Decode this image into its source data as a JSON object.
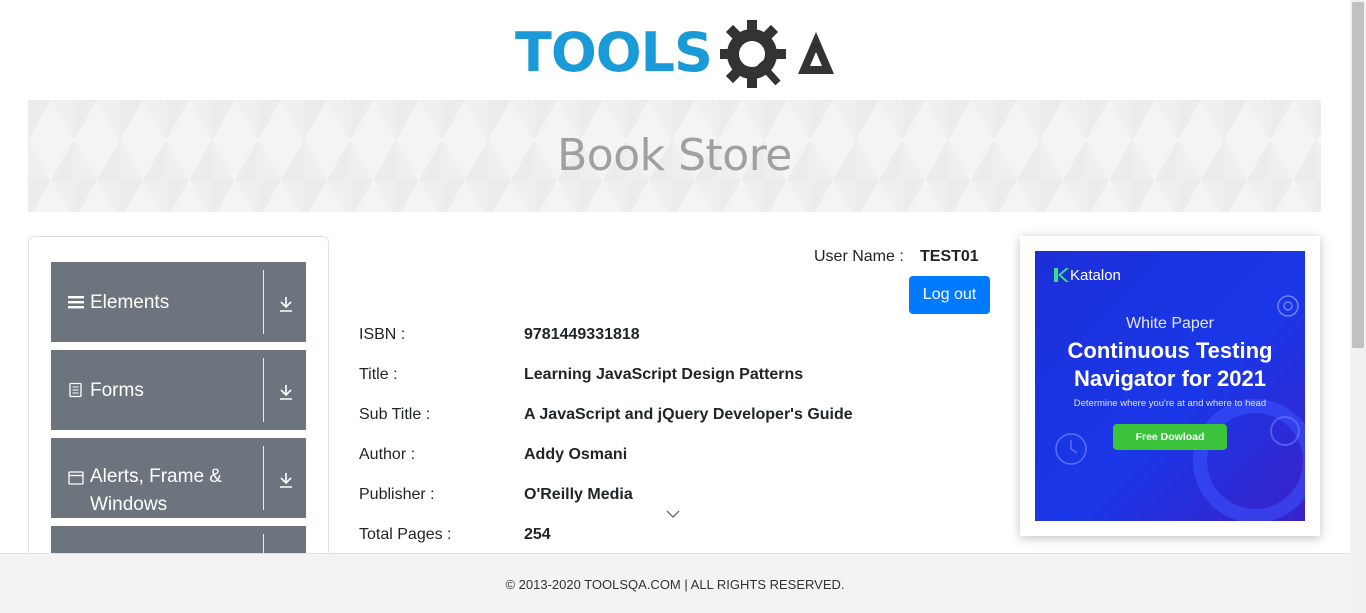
{
  "logo": {
    "text_blue": "TOOLS",
    "text_dark": "QA",
    "blue": "#1a9ad6",
    "dark": "#333333"
  },
  "banner": {
    "title": "Book Store"
  },
  "sidebar": {
    "groups": [
      {
        "label": "Elements",
        "icon": "hamburger-icon"
      },
      {
        "label": "Forms",
        "icon": "document-icon"
      },
      {
        "label": "Alerts, Frame & Windows",
        "icon": "window-icon"
      },
      {
        "label": "",
        "icon": ""
      }
    ],
    "color": "#6c757d"
  },
  "user": {
    "label": "User Name :",
    "value": "TEST01",
    "logout_label": "Log out"
  },
  "book": {
    "rows": [
      {
        "label": "ISBN :",
        "value": "9781449331818"
      },
      {
        "label": "Title :",
        "value": "Learning JavaScript Design Patterns"
      },
      {
        "label": "Sub Title :",
        "value": "A JavaScript and jQuery Developer's Guide"
      },
      {
        "label": "Author :",
        "value": "Addy Osmani"
      },
      {
        "label": "Publisher :",
        "value": "O'Reilly Media"
      },
      {
        "label": "Total Pages :",
        "value": "254"
      }
    ]
  },
  "ad": {
    "brand": "Katalon",
    "kicker": "White Paper",
    "headline_1": "Continuous Testing",
    "headline_2": "Navigator for 2021",
    "subtext": "Determine where you're at and where to head",
    "cta": "Free Dowload"
  },
  "footer": {
    "text": "© 2013-2020 TOOLSQA.COM | ALL RIGHTS RESERVED."
  },
  "colors": {
    "primary_button": "#007bff",
    "ad_background": "#1c2fd9",
    "ad_cta": "#3cc33c"
  }
}
